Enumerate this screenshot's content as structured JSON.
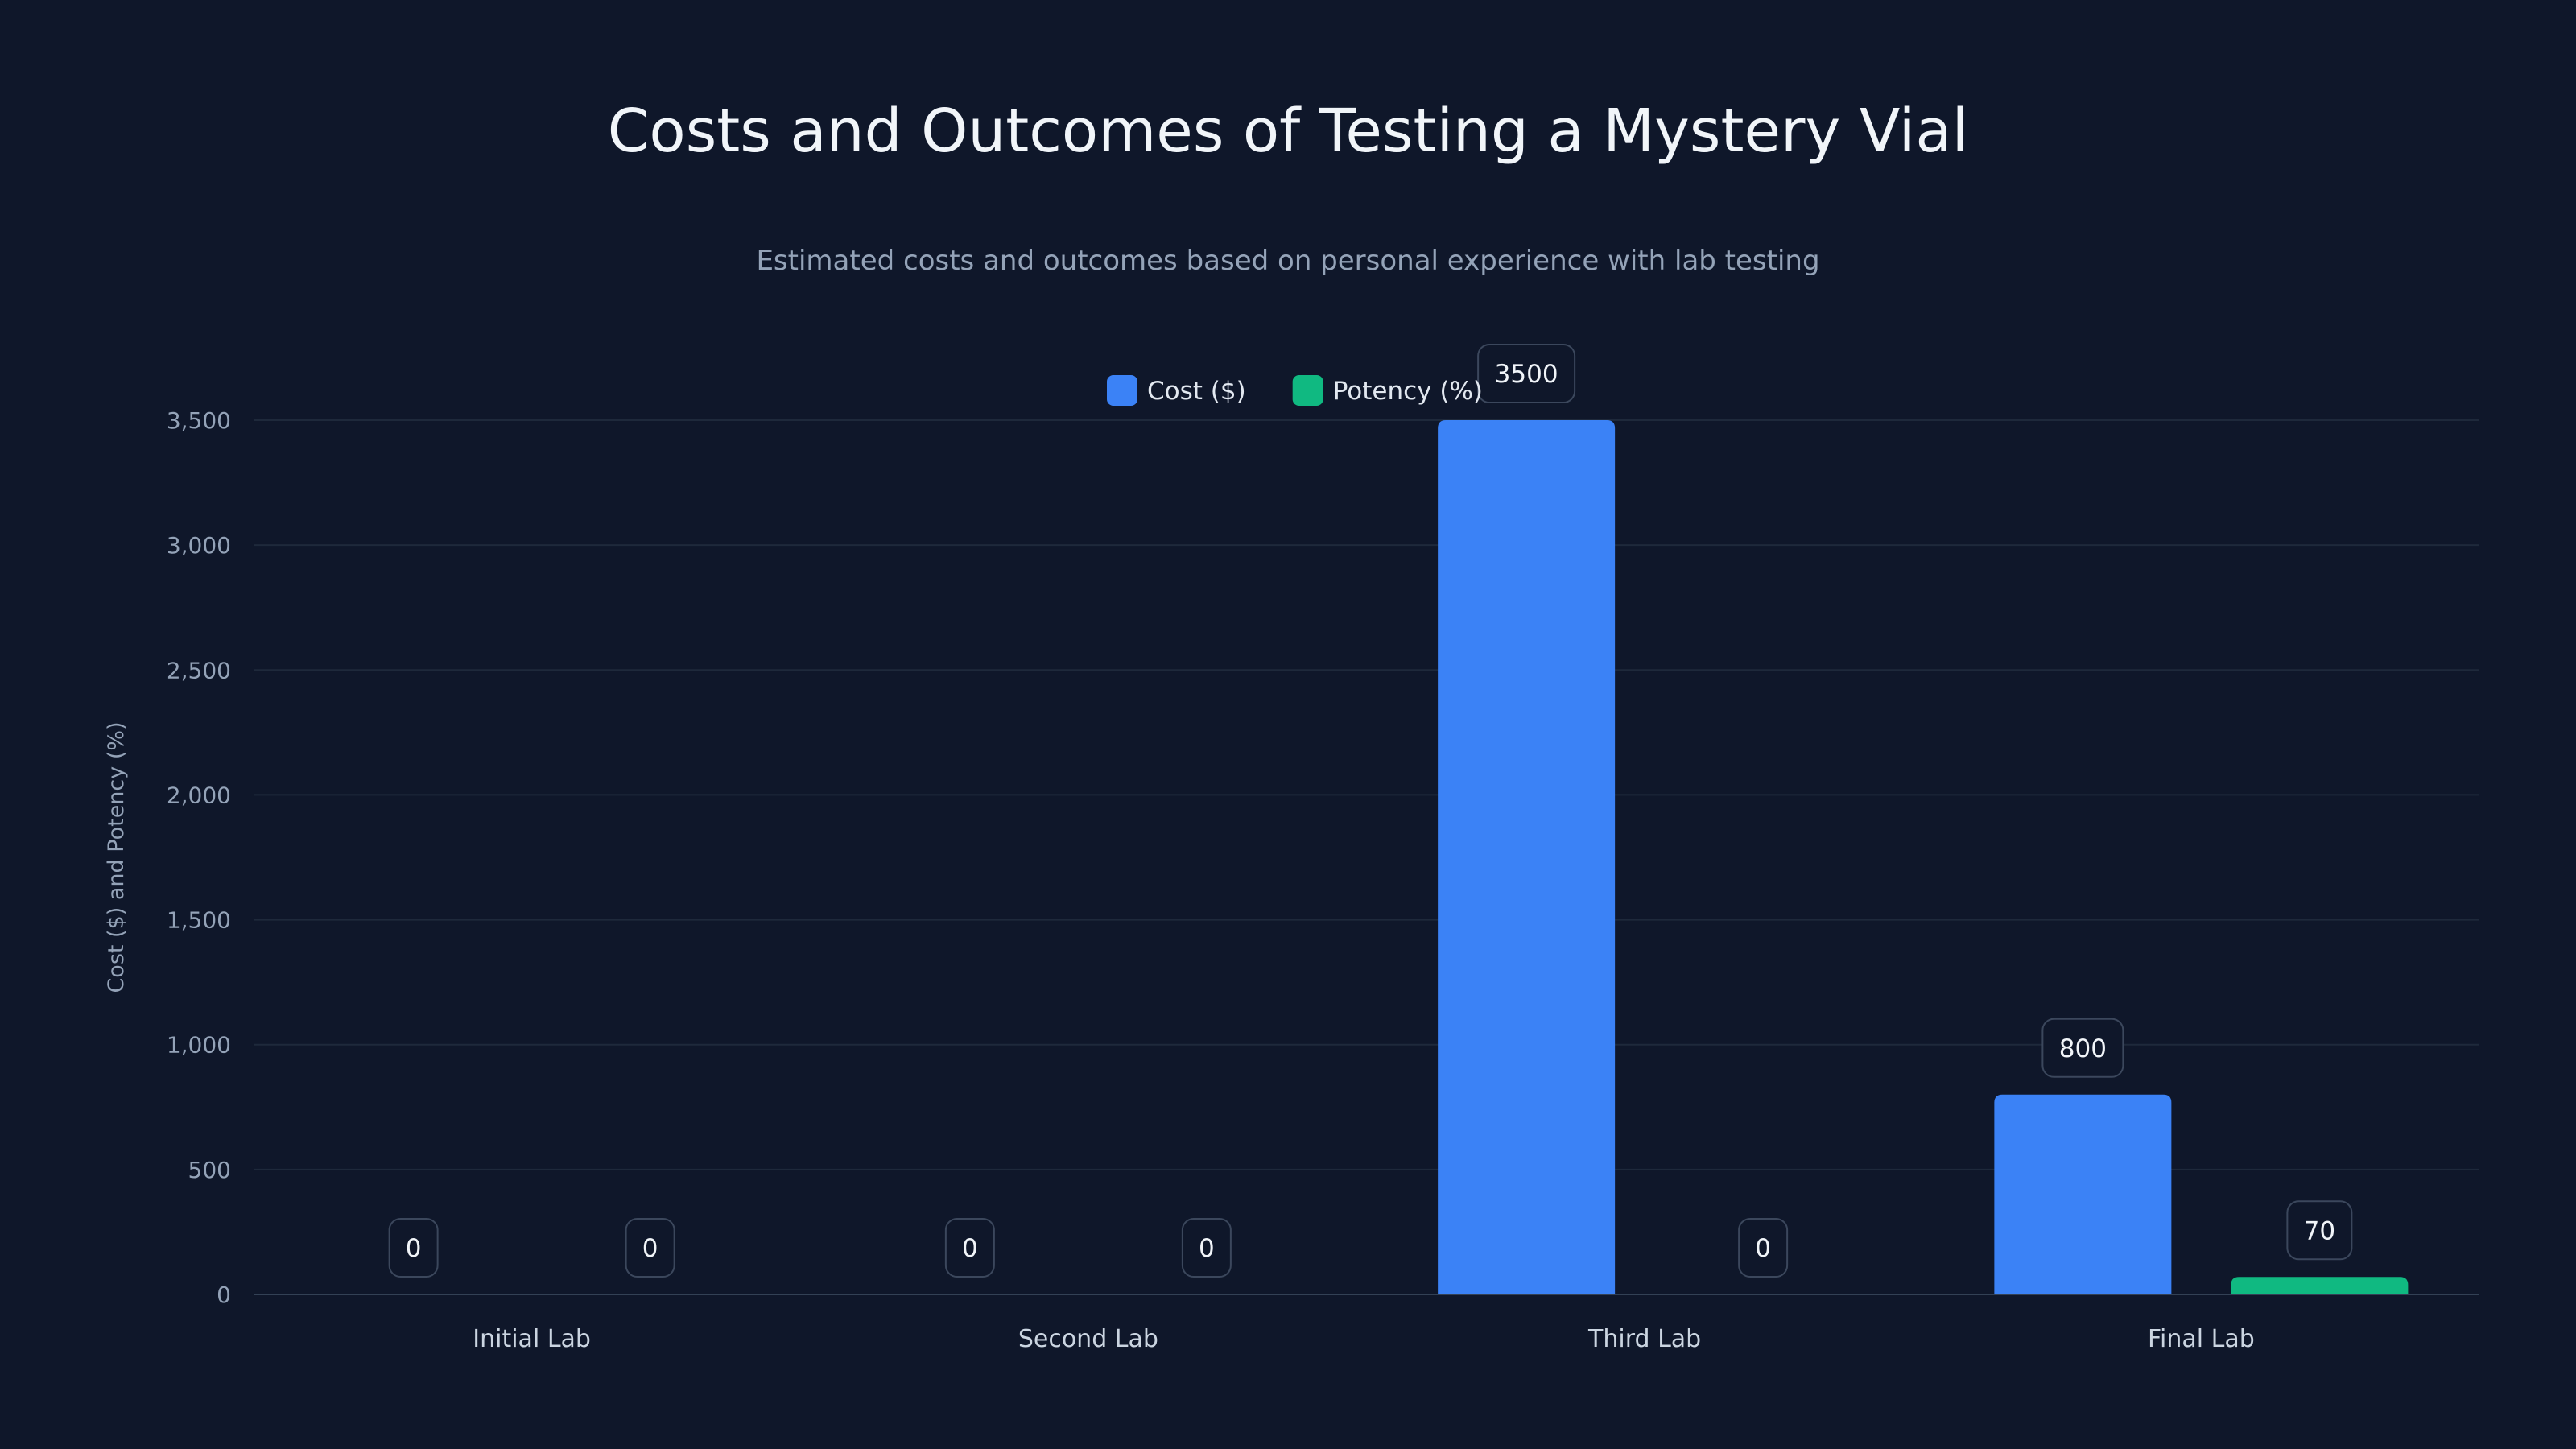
{
  "chart_data": {
    "type": "bar",
    "title": "Costs and Outcomes of Testing a Mystery Vial",
    "subtitle": "Estimated costs and outcomes based on personal experience with lab testing",
    "ylabel": "Cost ($) and Potency (%)",
    "xlabel": "",
    "categories": [
      "Initial Lab",
      "Second Lab",
      "Third Lab",
      "Final Lab"
    ],
    "series": [
      {
        "name": "Cost ($)",
        "color": "#3b82f6",
        "values": [
          0,
          0,
          3500,
          800
        ]
      },
      {
        "name": "Potency (%)",
        "color": "#10b981",
        "values": [
          0,
          0,
          0,
          70
        ]
      }
    ],
    "ylim": [
      0,
      3500
    ],
    "yticks": [
      0,
      500,
      1000,
      1500,
      2000,
      2500,
      3000,
      3500
    ],
    "yticklabels": [
      "0",
      "500",
      "1,000",
      "1,500",
      "2,000",
      "2,500",
      "3,000",
      "3,500"
    ],
    "grid": true,
    "legend": "top-center",
    "data_labels": true
  }
}
